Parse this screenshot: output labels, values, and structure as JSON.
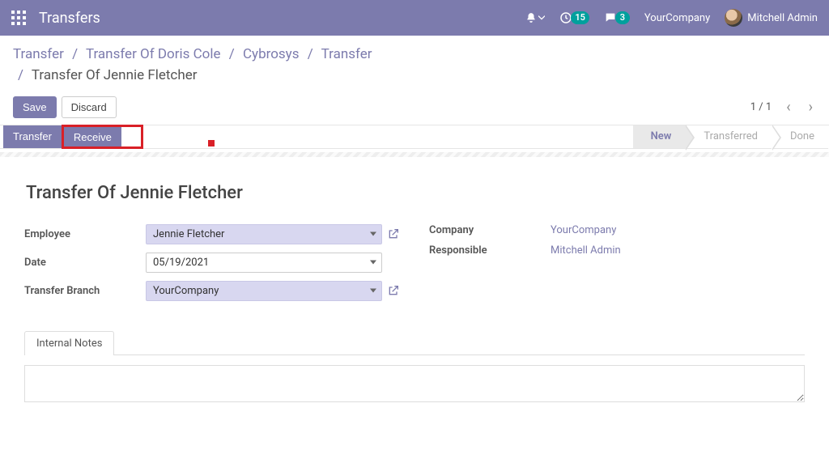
{
  "navbar": {
    "title": "Transfers",
    "activities_count": "15",
    "discuss_count": "3",
    "company_name": "YourCompany",
    "user_name": "Mitchell Admin"
  },
  "breadcrumb": {
    "items": [
      "Transfer",
      "Transfer Of Doris Cole",
      "Cybrosys",
      "Transfer"
    ],
    "current": "Transfer Of Jennie Fletcher"
  },
  "controls": {
    "save_label": "Save",
    "discard_label": "Discard",
    "pager_text": "1 / 1"
  },
  "actions": {
    "transfer_label": "Transfer",
    "receive_label": "Receive"
  },
  "status_steps": {
    "new": "New",
    "transferred": "Transferred",
    "done": "Done"
  },
  "form": {
    "title": "Transfer Of Jennie Fletcher",
    "labels": {
      "employee": "Employee",
      "date": "Date",
      "transfer_branch": "Transfer Branch",
      "company": "Company",
      "responsible": "Responsible"
    },
    "values": {
      "employee": "Jennie Fletcher",
      "date": "05/19/2021",
      "transfer_branch": "YourCompany",
      "company": "YourCompany",
      "responsible": "Mitchell Admin"
    }
  },
  "notebook": {
    "tab_label": "Internal Notes",
    "notes_value": ""
  }
}
